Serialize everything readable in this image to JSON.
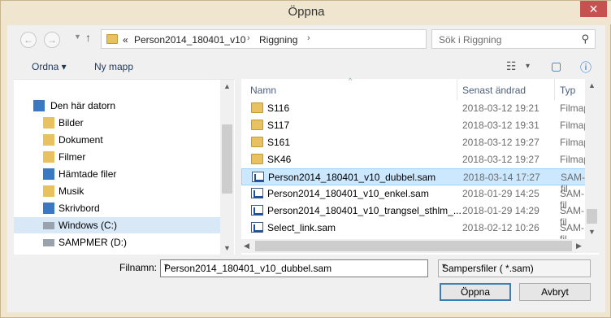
{
  "window": {
    "title": "Öppna"
  },
  "address": {
    "overflow": "«",
    "crumbs": [
      "Person2014_180401_v10",
      "Riggning"
    ],
    "sep": "›"
  },
  "search": {
    "placeholder": "Sök i Riggning"
  },
  "toolbar": {
    "organize": "Ordna ▾",
    "new_folder": "Ny mapp",
    "view_label": "▾"
  },
  "nav": {
    "items": [
      {
        "label": "Den här datorn",
        "icon": "computer-icon"
      },
      {
        "label": "Bilder",
        "icon": "pictures-icon"
      },
      {
        "label": "Dokument",
        "icon": "documents-icon"
      },
      {
        "label": "Filmer",
        "icon": "videos-icon"
      },
      {
        "label": "Hämtade filer",
        "icon": "downloads-icon"
      },
      {
        "label": "Musik",
        "icon": "music-icon"
      },
      {
        "label": "Skrivbord",
        "icon": "desktop-icon"
      },
      {
        "label": "Windows (C:)",
        "icon": "drive-icon"
      },
      {
        "label": "SAMPMER (D:)",
        "icon": "drive-icon"
      }
    ]
  },
  "files": {
    "headers": {
      "name": "Namn",
      "date": "Senast ändrad",
      "type": "Typ"
    },
    "rows": [
      {
        "name": "S116",
        "date": "2018-03-12 19:21",
        "type": "Filmapp",
        "kind": "folder"
      },
      {
        "name": "S117",
        "date": "2018-03-12 19:31",
        "type": "Filmapp",
        "kind": "folder"
      },
      {
        "name": "S161",
        "date": "2018-03-12 19:27",
        "type": "Filmapp",
        "kind": "folder"
      },
      {
        "name": "SK46",
        "date": "2018-03-12 19:27",
        "type": "Filmapp",
        "kind": "folder"
      },
      {
        "name": "Person2014_180401_v10_dubbel.sam",
        "date": "2018-03-14 17:27",
        "type": "SAM-fil",
        "kind": "sam",
        "selected": true
      },
      {
        "name": "Person2014_180401_v10_enkel.sam",
        "date": "2018-01-29 14:25",
        "type": "SAM-fil",
        "kind": "sam"
      },
      {
        "name": "Person2014_180401_v10_trangsel_sthlm_...",
        "date": "2018-01-29 14:29",
        "type": "SAM-fil",
        "kind": "sam"
      },
      {
        "name": "Select_link.sam",
        "date": "2018-02-12 10:26",
        "type": "SAM-fil",
        "kind": "sam"
      }
    ]
  },
  "bottom": {
    "filename_label": "Filnamn:",
    "filename_value": "Person2014_180401_v10_dubbel.sam",
    "filetype_value": "Sampersfiler ( *.sam)",
    "open_label": "Öppna",
    "cancel_label": "Avbryt"
  }
}
